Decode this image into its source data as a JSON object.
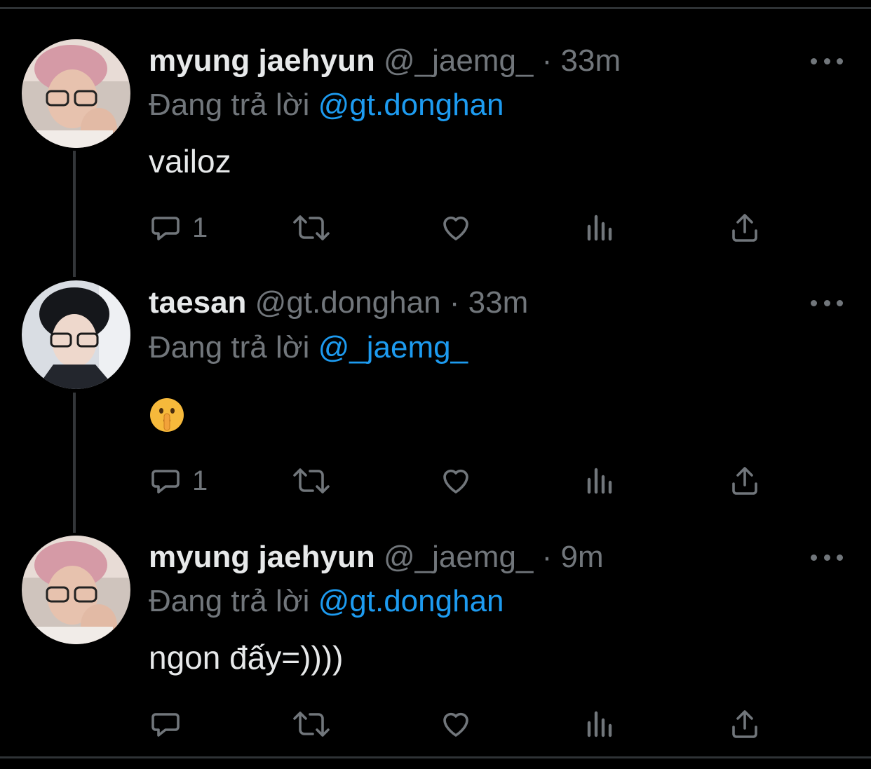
{
  "tweets": [
    {
      "name": "myung jaehyun",
      "handle": "@_jaemg_",
      "separator": "·",
      "time": "33m",
      "reply_prefix": "Đang trả lời",
      "reply_to": "@gt.donghan",
      "text": "vailoz",
      "reply_count": "1",
      "avatar": "avatar-photo-glasses-pink-hair"
    },
    {
      "name": "taesan",
      "handle": "@gt.donghan",
      "separator": "·",
      "time": "33m",
      "reply_prefix": "Đang trả lời",
      "reply_to": "@_jaemg_",
      "text": "🤫",
      "reply_count": "1",
      "avatar": "avatar-photo-glasses-dark-hair"
    },
    {
      "name": "myung jaehyun",
      "handle": "@_jaemg_",
      "separator": "·",
      "time": "9m",
      "reply_prefix": "Đang trả lời",
      "reply_to": "@gt.donghan",
      "text": "ngon đấy=))))",
      "reply_count": "",
      "avatar": "avatar-photo-glasses-pink-hair"
    }
  ],
  "icons": {
    "reply": "speech-bubble-icon",
    "retweet": "retweet-icon",
    "like": "heart-icon",
    "views": "bar-chart-icon",
    "share": "share-upload-icon",
    "more": "ellipsis-icon"
  },
  "colors": {
    "background": "#000000",
    "text": "#e7e9ea",
    "muted": "#71767b",
    "accent": "#1d9bf0"
  }
}
